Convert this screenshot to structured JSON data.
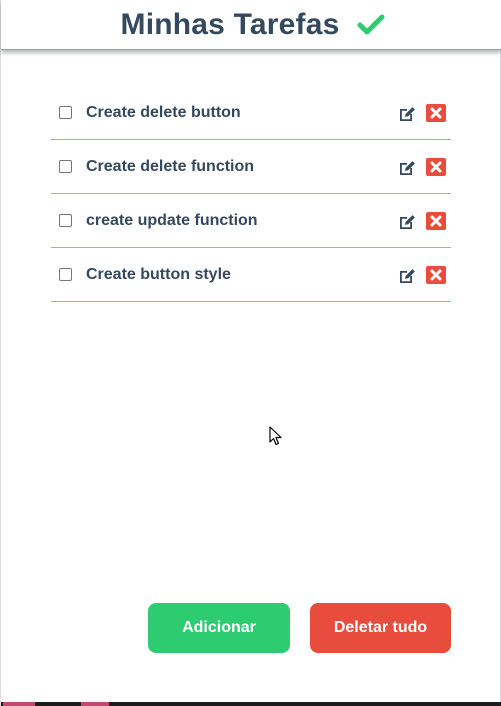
{
  "header": {
    "title": "Minhas Tarefas",
    "check_icon": "checkmark-icon",
    "check_color": "#2ecc71"
  },
  "tasks": [
    {
      "label": "Create delete button",
      "checked": false
    },
    {
      "label": "Create delete function",
      "checked": false
    },
    {
      "label": "create update function",
      "checked": false
    },
    {
      "label": "Create button style",
      "checked": false
    }
  ],
  "icons": {
    "edit": "edit-pencil-icon",
    "delete": "delete-x-icon"
  },
  "buttons": {
    "add_label": "Adicionar",
    "clear_label": "Deletar tudo"
  },
  "colors": {
    "text": "#34495e",
    "divider": "#e8a33d",
    "add": "#2ecc71",
    "delete": "#e74c3c"
  }
}
